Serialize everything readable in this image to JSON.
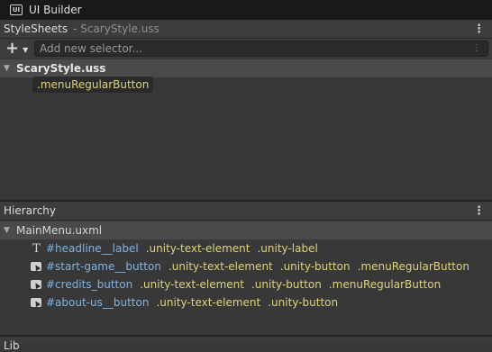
{
  "window": {
    "title": "UI Builder",
    "icon": "ui-builder-icon"
  },
  "stylesheets": {
    "header_title": "StyleSheets",
    "header_subtitle": "- ScaryStyle.uss",
    "add_placeholder": "Add new selector...",
    "sheet_name": "ScaryStyle.uss",
    "selectors": [
      ".menuRegularButton"
    ]
  },
  "hierarchy": {
    "header_title": "Hierarchy",
    "document_name": "MainMenu.uxml",
    "elements": [
      {
        "icon": "text-element-icon",
        "name": "#headline__label",
        "classes": [
          ".unity-text-element",
          ".unity-label"
        ]
      },
      {
        "icon": "button-element-icon",
        "name": "#start-game__button",
        "classes": [
          ".unity-text-element",
          ".unity-button",
          ".menuRegularButton"
        ]
      },
      {
        "icon": "button-element-icon",
        "name": "#credits_button",
        "classes": [
          ".unity-text-element",
          ".unity-button",
          ".menuRegularButton"
        ]
      },
      {
        "icon": "button-element-icon",
        "name": "#about-us__button",
        "classes": [
          ".unity-text-element",
          ".unity-button"
        ]
      }
    ]
  },
  "bottom_panel": {
    "title": "Lib"
  },
  "colors": {
    "class_yellow": "#e0d27a",
    "name_blue": "#7fb2e5",
    "panel_bg": "#383838"
  }
}
